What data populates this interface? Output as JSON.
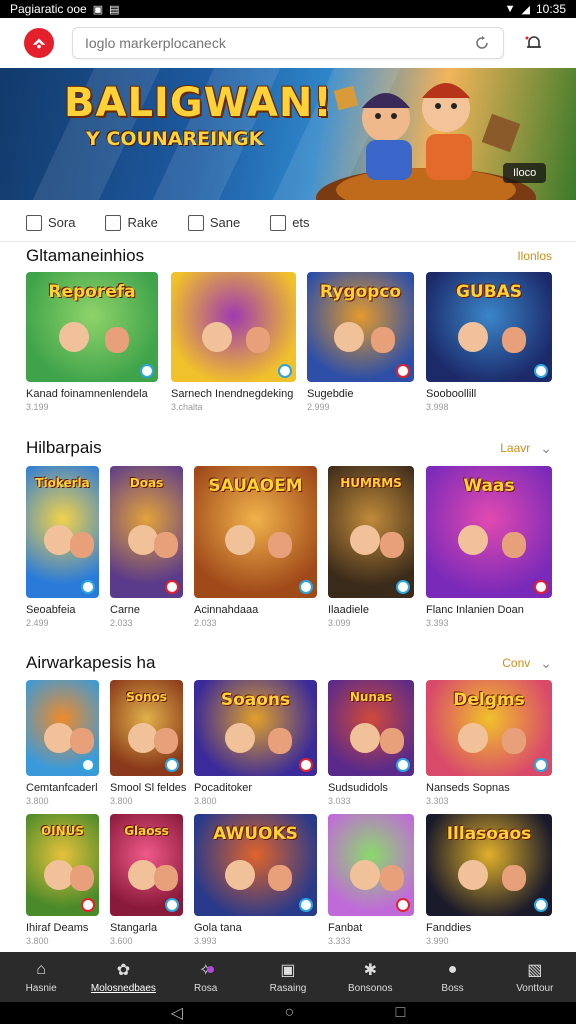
{
  "status_bar": {
    "left_text": "Pagiaratic ooe",
    "time": "10:35"
  },
  "search": {
    "value": "",
    "placeholder": "Ioglo markerplocaneck"
  },
  "banner": {
    "title": "BALIGWAN!",
    "subtitle": "Y COUNAREINGK",
    "tag": "Iloco"
  },
  "categories": [
    {
      "label": "Sora",
      "icon": "rocket-icon"
    },
    {
      "label": "Rake",
      "icon": "grid-icon"
    },
    {
      "label": "Sane",
      "icon": "gallery-icon"
    },
    {
      "label": "ets",
      "icon": "calendar-icon"
    }
  ],
  "sections": [
    {
      "title": "Gltamaneinhios",
      "link": "Ilonlos",
      "chevron": false,
      "items": [
        {
          "art_title": "Reporefa",
          "caption": "Kanad foinamnenlendela",
          "sub": "3.199"
        },
        {
          "art_title": "",
          "caption": "Sarnech Inendnegdeking",
          "sub": "3.chalta"
        },
        {
          "art_title": "Rygopco",
          "caption": "Sugebdie",
          "sub": "2.999"
        },
        {
          "art_title": "GUBAS",
          "caption": "Sooboollill",
          "sub": "3.998"
        }
      ]
    },
    {
      "title": "Hilbarpais",
      "link": "Laavr",
      "chevron": true,
      "items": [
        {
          "art_title": "Tiokerla",
          "caption": "Seoabfeia",
          "sub": "2.499"
        },
        {
          "art_title": "Doas",
          "caption": "Carne",
          "sub": "2.033"
        },
        {
          "art_title": "SAUAOEM",
          "caption": "Acinnahdaaa",
          "sub": "2.033"
        },
        {
          "art_title": "HUMRMS",
          "caption": "Ilaadiele",
          "sub": "3.099"
        },
        {
          "art_title": "Waas",
          "caption": "Flanc Inlanien Doan",
          "sub": "3.393"
        }
      ]
    },
    {
      "title": "Airwarkapesis ha",
      "link": "Conv",
      "chevron": true,
      "items": [
        {
          "art_title": "",
          "caption": "Cemtanfcaderl",
          "sub": "3.800"
        },
        {
          "art_title": "Sonos",
          "caption": "Smool Sl feldes",
          "sub": "3.800"
        },
        {
          "art_title": "Soaons",
          "caption": "Pocaditoker",
          "sub": "3.800"
        },
        {
          "art_title": "Nunas",
          "caption": "Sudsudidols",
          "sub": "3.033"
        },
        {
          "art_title": "Delgms",
          "caption": "Nanseds Sopnas",
          "sub": "3.303"
        },
        {
          "art_title": "OINUS",
          "caption": "Ihiraf Deams",
          "sub": "3.800"
        },
        {
          "art_title": "Glaoss",
          "caption": "Stangarla",
          "sub": "3.600"
        },
        {
          "art_title": "AWUOKS",
          "caption": "Gola tana",
          "sub": "3.993"
        },
        {
          "art_title": "",
          "caption": "Fanbat",
          "sub": "3.333"
        },
        {
          "art_title": "Illasoaos",
          "caption": "Fanddies",
          "sub": "3.990"
        }
      ]
    }
  ],
  "bottom_nav": [
    {
      "label": "Hasnie",
      "icon": "home-icon",
      "active": false
    },
    {
      "label": "Molosnedbaes",
      "icon": "flower-icon",
      "active": true
    },
    {
      "label": "Rosa",
      "icon": "sparkle-icon",
      "active": false
    },
    {
      "label": "Rasaing",
      "icon": "box-icon",
      "active": false
    },
    {
      "label": "Bonsonos",
      "icon": "bug-icon",
      "active": false
    },
    {
      "label": "Boss",
      "icon": "person-icon",
      "active": false
    },
    {
      "label": "Vonttour",
      "icon": "picture-icon",
      "active": false
    }
  ],
  "colors": {
    "brand": "#e3202c",
    "accent": "#d18c1b",
    "nav_bg": "#2b2b2b"
  }
}
